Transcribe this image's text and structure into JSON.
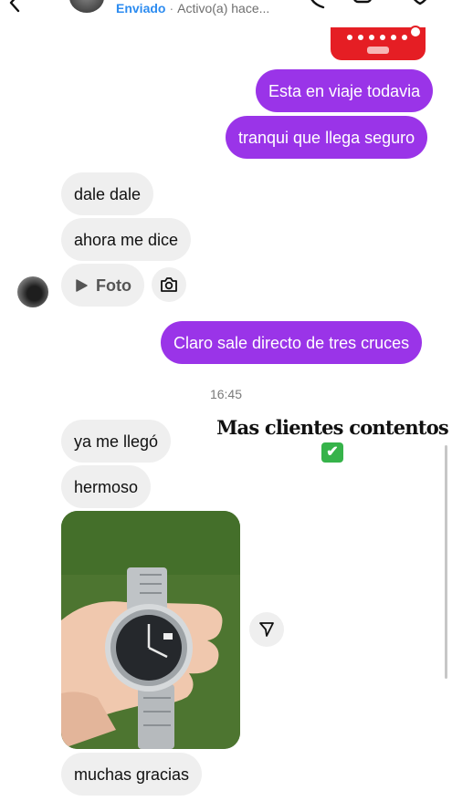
{
  "header": {
    "status": "Enviado",
    "separator": "·",
    "activity": "Activo(a) hace..."
  },
  "icons": {
    "back": "chevron-left-icon",
    "call": "phone-icon",
    "video": "video-camera-icon",
    "heart": "heart-icon",
    "camera": "camera-icon",
    "share": "send-icon",
    "play": "play-icon"
  },
  "messages": [
    {
      "side": "out",
      "text": "Esta en viaje todavia"
    },
    {
      "side": "out",
      "text": "tranqui que llega seguro"
    },
    {
      "side": "in",
      "text": "dale dale"
    },
    {
      "side": "in",
      "text": "ahora me dice"
    },
    {
      "side": "in",
      "text": "Foto"
    },
    {
      "side": "out",
      "text": "Claro sale directo de tres cruces"
    },
    {
      "side": "in",
      "text": "ya me llegó"
    },
    {
      "side": "in",
      "text": "hermoso"
    },
    {
      "side": "in",
      "text": "muchas gracias"
    }
  ],
  "time_separator": "16:45",
  "caption": {
    "text": "Mas clientes contentos",
    "emoji": "✔"
  },
  "colors": {
    "outgoing_bubble": "#9a34e8",
    "incoming_bubble": "#efefef",
    "accent_blue": "#2d8cf0",
    "promo_red": "#e51e24",
    "check_green": "#36b34a"
  }
}
